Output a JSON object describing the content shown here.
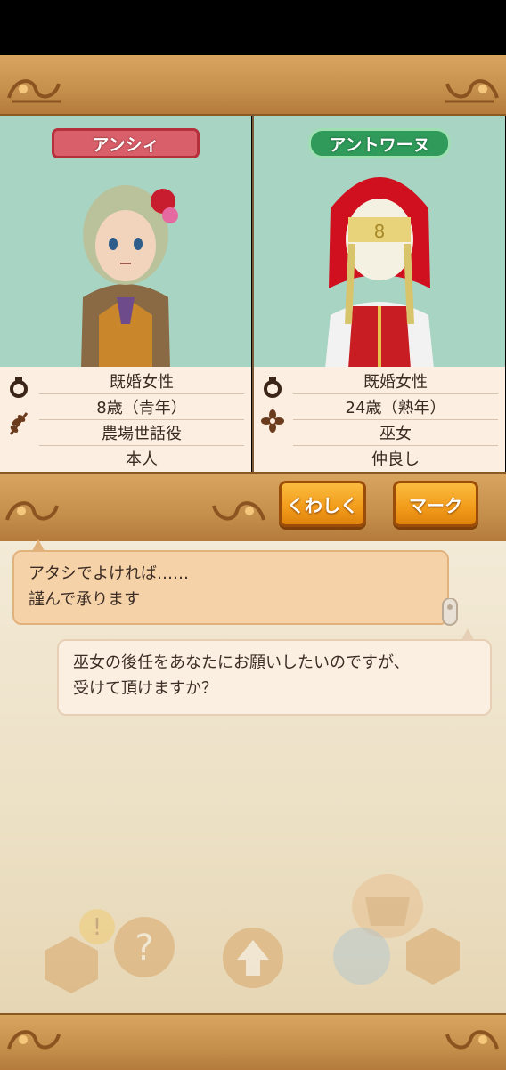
{
  "characters": [
    {
      "name": "アンシィ",
      "plate_color": "#d9606b",
      "details": [
        "既婚女性",
        "8歳（青年）",
        "農場世話役",
        "本人"
      ],
      "icons": [
        "ring-icon",
        "wheat-icon"
      ]
    },
    {
      "name": "アントワーヌ",
      "plate_color": "#2f9a5a",
      "details": [
        "既婚女性",
        "24歳（熟年）",
        "巫女",
        "仲良し"
      ],
      "icons": [
        "ring-icon",
        "flower-icon"
      ]
    }
  ],
  "buttons": {
    "details": "くわしく",
    "mark": "マーク"
  },
  "dialogue": {
    "reply_line1": "アタシでよければ……",
    "reply_line2": "謹んで承ります",
    "request_line1": "巫女の後任をあなたにお願いしたいのですが、",
    "request_line2": "受けて頂けますか？"
  },
  "colors": {
    "panel_bg": "#a8d4c3",
    "gold_band": "#c58f4c",
    "button_orange": "#f29b1a"
  }
}
